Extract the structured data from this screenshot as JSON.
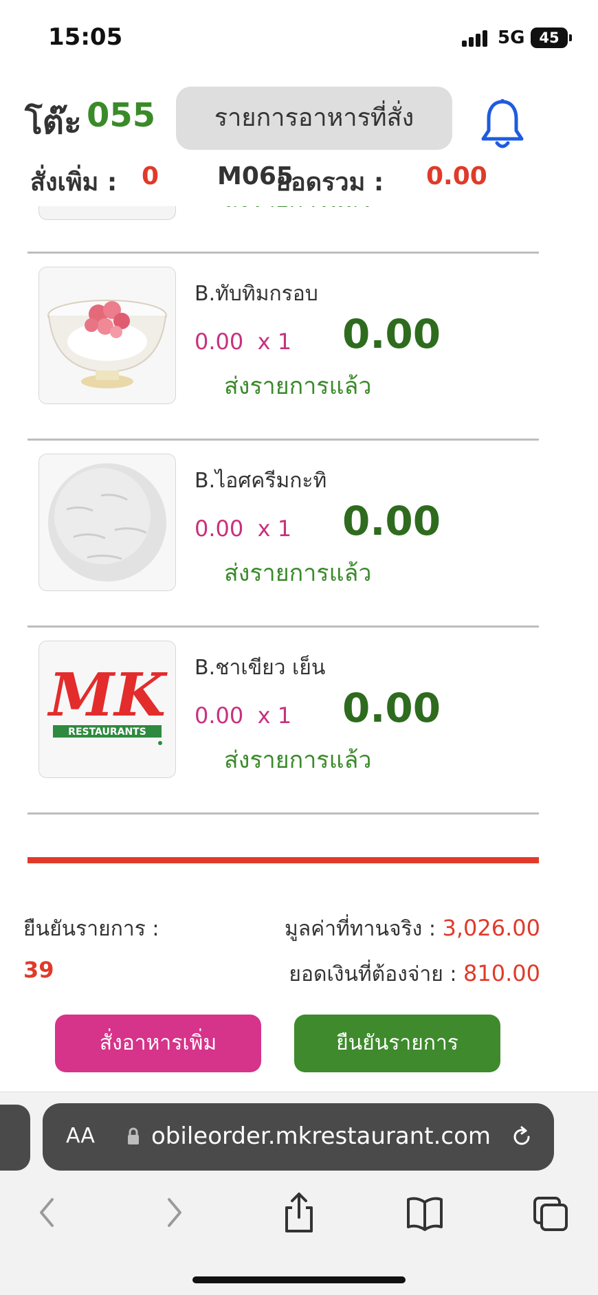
{
  "status_bar": {
    "time": "15:05",
    "network": "5G",
    "battery": "45"
  },
  "header": {
    "table_label": "โต๊ะ",
    "table_number": "055",
    "orders_button": "รายการอาหารที่สั่ง",
    "bell_icon": "bell-icon"
  },
  "subbar": {
    "order_more_label": "สั่งเพิ่ม :",
    "order_more_value": "0",
    "code": "M065",
    "total_label": "ยอดรวม :",
    "total_value": "0.00"
  },
  "items": [
    {
      "name": "",
      "price": "",
      "qty": "",
      "total": "",
      "status": "ส่งรายการแล้ว",
      "image": "partial"
    },
    {
      "name": "B.ทับทิมกรอบ",
      "price": "0.00",
      "qty": "x 1",
      "total": "0.00",
      "status": "ส่งรายการแล้ว",
      "image": "tubtim-krob-dessert"
    },
    {
      "name": "B.ไอศครีมกะทิ",
      "price": "0.00",
      "qty": "x 1",
      "total": "0.00",
      "status": "ส่งรายการแล้ว",
      "image": "coconut-ice-cream"
    },
    {
      "name": "B.ชาเขียว เย็น",
      "price": "0.00",
      "qty": "x 1",
      "total": "0.00",
      "status": "ส่งรายการแล้ว",
      "image": "mk-restaurants-logo"
    }
  ],
  "logo": {
    "text": "MK",
    "sub": "RESTAURANTS"
  },
  "summary": {
    "confirm_label": "ยืนยันรายการ :",
    "confirm_value": "39",
    "actual_value_label": "มูลค่าที่ทานจริง :",
    "actual_value": "3,026.00",
    "to_pay_label": "ยอดเงินที่ต้องจ่าย :",
    "to_pay_value": "810.00"
  },
  "buttons": {
    "order_more": "สั่งอาหารเพิ่ม",
    "confirm": "ยืนยันรายการ"
  },
  "browser": {
    "aa_label": "AA",
    "url": "obileorder.mkrestaurant.com",
    "toolbar_icons": [
      "back-icon",
      "forward-icon",
      "share-icon",
      "bookmarks-icon",
      "tabs-icon"
    ]
  },
  "colors": {
    "accent_green": "#3a8a2a",
    "dark_green": "#2e6b1e",
    "magenta": "#c8317e",
    "red": "#e03a2a",
    "pink_button": "#d6338a",
    "green_button": "#3e8a2c"
  }
}
